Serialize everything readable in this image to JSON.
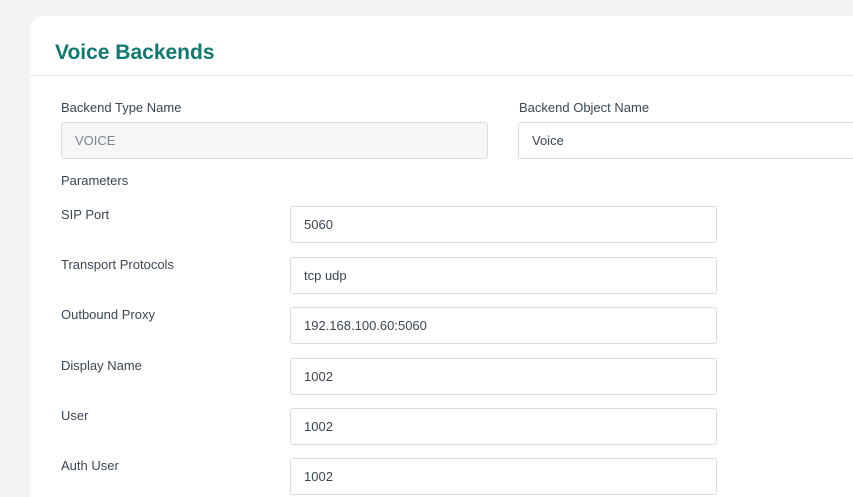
{
  "card": {
    "title": "Voice Backends"
  },
  "backend_type": {
    "label": "Backend Type Name",
    "value": "VOICE"
  },
  "backend_object": {
    "label": "Backend Object Name",
    "value": "Voice"
  },
  "parameters": {
    "heading": "Parameters",
    "fields": [
      {
        "label": "SIP Port",
        "value": "5060"
      },
      {
        "label": "Transport Protocols",
        "value": "tcp udp"
      },
      {
        "label": "Outbound Proxy",
        "value": "192.168.100.60:5060"
      },
      {
        "label": "Display Name",
        "value": "1002"
      },
      {
        "label": "User",
        "value": "1002"
      },
      {
        "label": "Auth User",
        "value": "1002"
      }
    ]
  },
  "colors": {
    "title": "#0f7a72",
    "page_background": "#f1f4f3",
    "readonly_background": "#f5f6f8"
  }
}
